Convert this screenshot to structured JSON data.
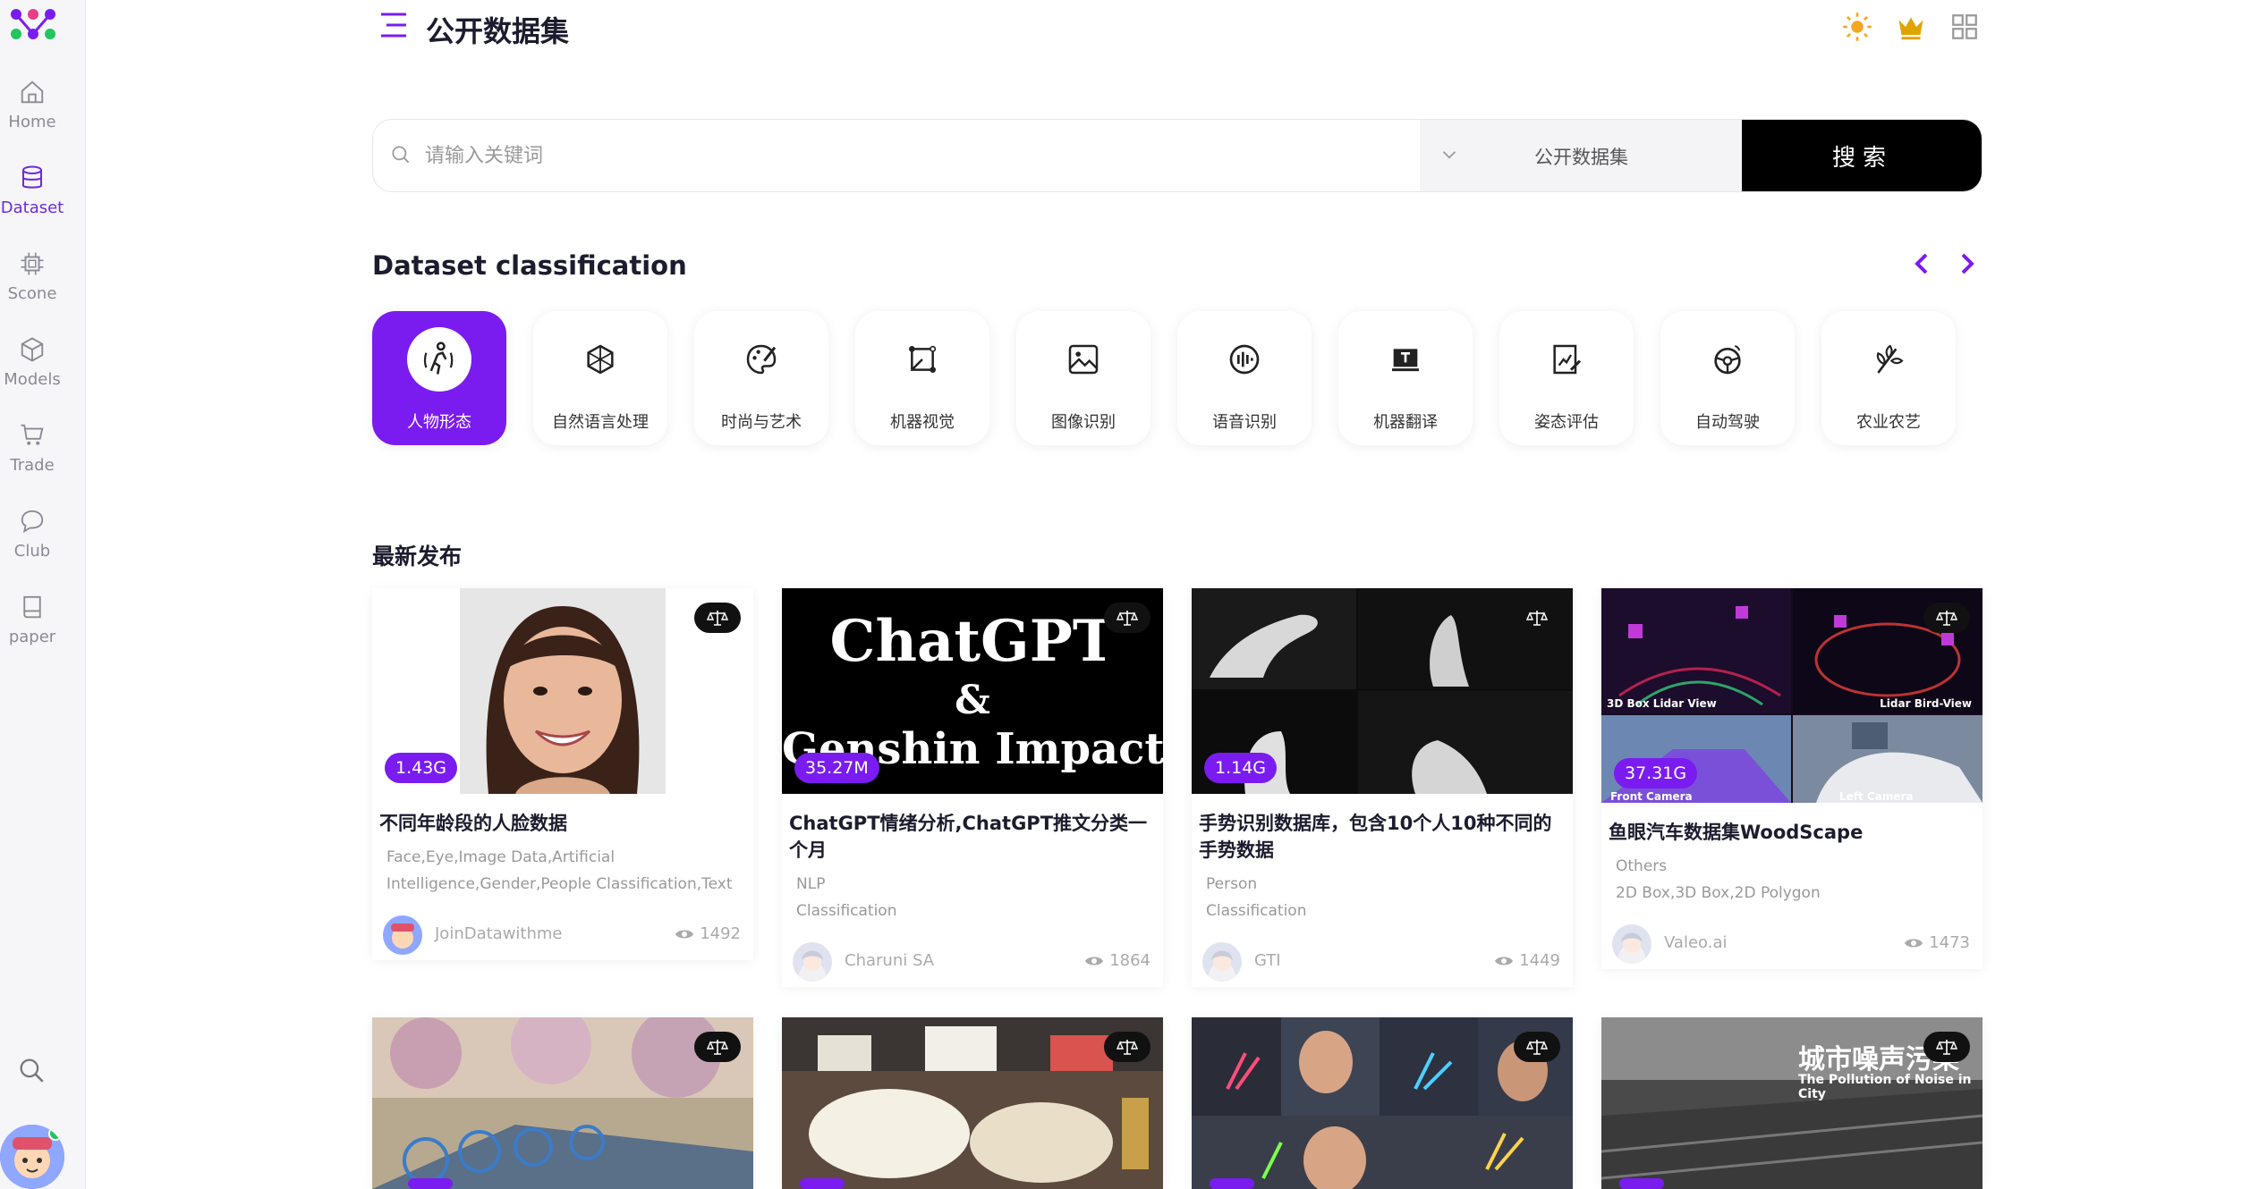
{
  "sidebar": {
    "items": [
      {
        "label": "Home",
        "icon": "home-icon"
      },
      {
        "label": "Dataset",
        "icon": "database-icon",
        "active": true
      },
      {
        "label": "Scone",
        "icon": "chip-icon"
      },
      {
        "label": "Models",
        "icon": "cube-icon"
      },
      {
        "label": "Trade",
        "icon": "cart-icon"
      },
      {
        "label": "Club",
        "icon": "chat-icon"
      },
      {
        "label": "paper",
        "icon": "book-icon"
      }
    ]
  },
  "header": {
    "title": "公开数据集"
  },
  "search": {
    "placeholder": "请输入关键词",
    "scope": "公开数据集",
    "button": "搜索"
  },
  "classification": {
    "title": "Dataset classification",
    "items": [
      {
        "label": "人物形态",
        "active": true
      },
      {
        "label": "自然语言处理"
      },
      {
        "label": "时尚与艺术"
      },
      {
        "label": "机器视觉"
      },
      {
        "label": "图像识别"
      },
      {
        "label": "语音识别"
      },
      {
        "label": "机器翻译"
      },
      {
        "label": "姿态评估"
      },
      {
        "label": "自动驾驶"
      },
      {
        "label": "农业农艺"
      }
    ]
  },
  "latest": {
    "title": "最新发布",
    "cards": [
      {
        "size": "1.43G",
        "title": "不同年龄段的人脸数据",
        "tags": "Face,Eye,Image Data,Artificial Intelligence,Gender,People Classification,Text",
        "author": "JoinDatawithme",
        "views": "1492"
      },
      {
        "size": "35.27M",
        "title": "ChatGPT情绪分析,ChatGPT推文分类一个月",
        "tags": "NLP\nClassification",
        "author": "Charuni SA",
        "views": "1864",
        "image_text": [
          "ChatGPT",
          "&",
          "Genshin Impact"
        ]
      },
      {
        "size": "1.14G",
        "title": "手势识别数据库，包含10个人10种不同的手势数据",
        "tags": "Person\nClassification",
        "author": "GTI",
        "views": "1449"
      },
      {
        "size": "37.31G",
        "title": "鱼眼汽车数据集WoodScape",
        "tags": "Others\n2D Box,3D Box,2D Polygon",
        "author": "Valeo.ai",
        "views": "1473",
        "image_text": [
          "3D Box Lidar View",
          "Lidar Bird-View",
          "Front Camera",
          "Left Camera"
        ]
      }
    ],
    "row2_image_text": [
      "城市噪声污染",
      "The Pollution of Noise in City"
    ]
  },
  "colors": {
    "accent": "#7a1cf0",
    "sidebar_active": "#6c2bd9"
  }
}
